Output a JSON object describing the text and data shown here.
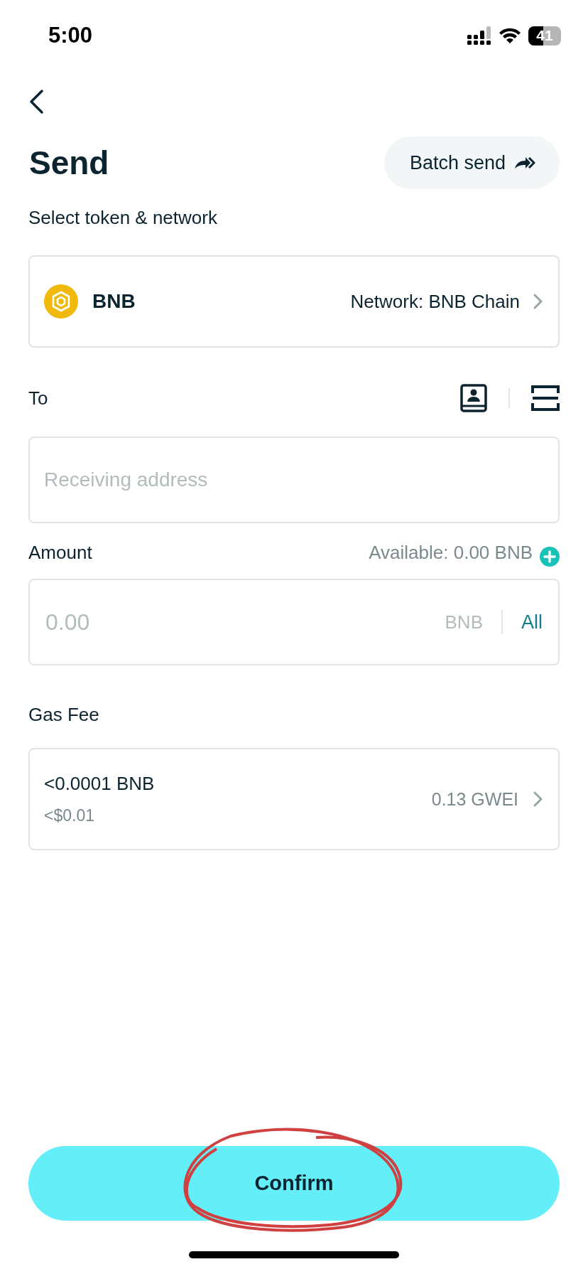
{
  "status_bar": {
    "time": "5:00",
    "battery": "41"
  },
  "header": {
    "title": "Send",
    "batch_button": "Batch send"
  },
  "token_section": {
    "label": "Select token & network",
    "token": "BNB",
    "network": "Network: BNB Chain"
  },
  "to_section": {
    "label": "To",
    "address_field": {
      "placeholder": "Receiving address"
    }
  },
  "amount_section": {
    "label": "Amount",
    "available": "Available: 0.00 BNB",
    "amount_field": {
      "placeholder": "0.00"
    },
    "unit": "BNB",
    "all_button": "All"
  },
  "gas_fee": {
    "label": "Gas Fee",
    "amount": "<0.0001 BNB",
    "fiat": "<$0.01",
    "price": "0.13 GWEI"
  },
  "confirm_button": "Confirm"
}
